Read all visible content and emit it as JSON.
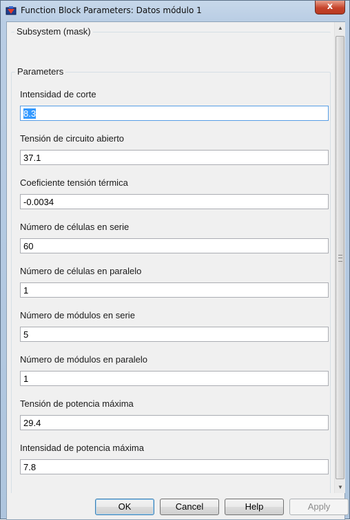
{
  "window": {
    "title": "Function Block Parameters: Datos módulo 1",
    "close_label": "x"
  },
  "mask_group": {
    "legend": "Subsystem (mask)"
  },
  "params_group": {
    "legend": "Parameters"
  },
  "fields": [
    {
      "label": "Intensidad de corte",
      "value": "8.3"
    },
    {
      "label": "Tensión de circuito abierto",
      "value": "37.1"
    },
    {
      "label": "Coeficiente tensión térmica",
      "value": "-0.0034"
    },
    {
      "label": "Número de células en serie",
      "value": "60"
    },
    {
      "label": "Número de células en paralelo",
      "value": "1"
    },
    {
      "label": "Número de módulos en serie",
      "value": "5"
    },
    {
      "label": "Número de módulos en paralelo",
      "value": "1"
    },
    {
      "label": "Tensión de potencia máxima",
      "value": "29.4"
    },
    {
      "label": "Intensidad de potencia máxima",
      "value": "7.8"
    }
  ],
  "buttons": {
    "ok": "OK",
    "cancel": "Cancel",
    "help": "Help",
    "apply": "Apply"
  },
  "scrollbar": {
    "up_arrow": "▲",
    "down_arrow": "▼"
  }
}
